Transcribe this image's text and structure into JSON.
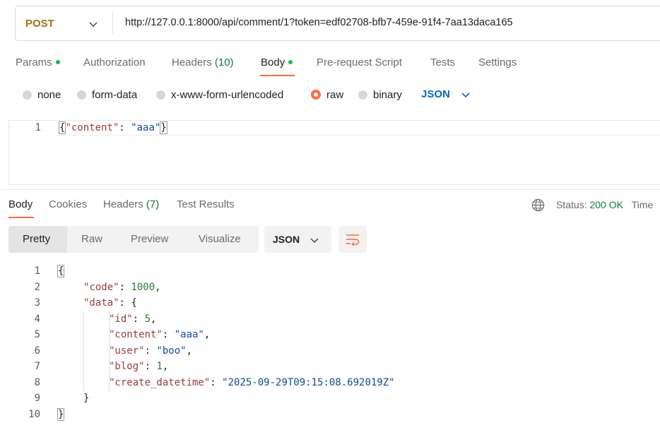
{
  "request": {
    "method": "POST",
    "url": "http://127.0.0.1:8000/api/comment/1?token=edf02708-bfb7-459e-91f4-7aa13daca165"
  },
  "request_tabs": [
    {
      "label": "Params"
    },
    {
      "label": "Authorization"
    },
    {
      "label": "Headers",
      "count": "(10)"
    },
    {
      "label": "Body"
    },
    {
      "label": "Pre-request Script"
    },
    {
      "label": "Tests"
    },
    {
      "label": "Settings"
    }
  ],
  "body_modes": [
    {
      "label": "none"
    },
    {
      "label": "form-data"
    },
    {
      "label": "x-www-form-urlencoded"
    },
    {
      "label": "raw"
    },
    {
      "label": "binary"
    }
  ],
  "body_format": "JSON",
  "request_body": {
    "line_number": "1",
    "open": "{",
    "key": "\"content\"",
    "colon": ": ",
    "value": "\"aaa\"",
    "close": "}"
  },
  "response_tabs": [
    {
      "label": "Body"
    },
    {
      "label": "Cookies"
    },
    {
      "label": "Headers",
      "count": "(7)"
    },
    {
      "label": "Test Results"
    }
  ],
  "status": {
    "label": "Status:",
    "value": "200 OK",
    "time_label": "Time"
  },
  "view_modes": [
    "Pretty",
    "Raw",
    "Preview",
    "Visualize"
  ],
  "response_format": "JSON",
  "response_lines": {
    "numbers": [
      "1",
      "2",
      "3",
      "4",
      "5",
      "6",
      "7",
      "8",
      "9",
      "10"
    ],
    "open_brace": "{",
    "code_key": "\"code\"",
    "code_val": "1000",
    "data_key": "\"data\"",
    "data_open": "{",
    "id_key": "\"id\"",
    "id_val": "5",
    "content_key": "\"content\"",
    "content_val": "\"aaa\"",
    "user_key": "\"user\"",
    "user_val": "\"boo\"",
    "blog_key": "\"blog\"",
    "blog_val": "1",
    "dt_key": "\"create_datetime\"",
    "dt_val": "\"2025-09-29T09:15:08.692019Z\"",
    "data_close": "}",
    "close_brace": "}"
  },
  "colors": {
    "accent": "#ff6c37",
    "method": "#a07118",
    "success": "#0a7d3d",
    "link": "#0265d2"
  }
}
